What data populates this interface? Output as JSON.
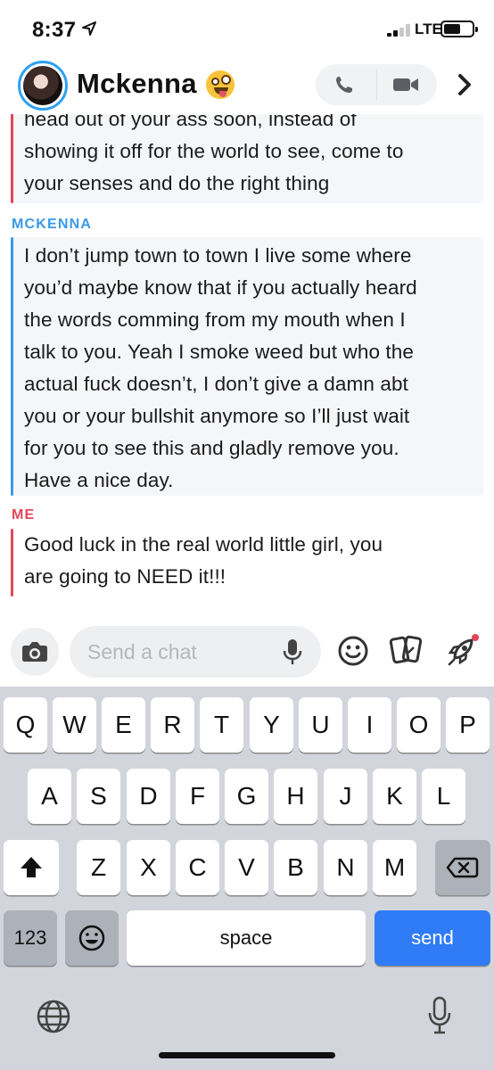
{
  "status_bar": {
    "time": "8:37",
    "network": "LTE"
  },
  "header": {
    "contact_name": "Mckenna",
    "emoji": "zany-face-emoji"
  },
  "messages": [
    {
      "sender": "",
      "color": "#e0475a",
      "text": "head out of your ass soon, instead of\nshowing it off for the world to see, come to\nyour senses and do the right thing"
    },
    {
      "sender": "MCKENNA",
      "color": "#3a9ae8",
      "text": "I don’t jump town to town I live some where\nyou’d maybe know that if you actually heard\nthe words comming  from my mouth when I\ntalk to you. Yeah I smoke weed but who the\nactual fuck doesn’t, I don’t give a damn abt\nyou or your bullshit anymore so I’ll just wait\nfor you to see this and gladly remove you.\nHave a nice day."
    },
    {
      "sender": "ME",
      "color": "#e0475a",
      "text": "Good luck in the real world little girl, you\nare going to NEED it!!!"
    }
  ],
  "composer": {
    "placeholder": "Send a chat",
    "value": ""
  },
  "keyboard": {
    "row1": [
      "Q",
      "W",
      "E",
      "R",
      "T",
      "Y",
      "U",
      "I",
      "O",
      "P"
    ],
    "row2": [
      "A",
      "S",
      "D",
      "F",
      "G",
      "H",
      "J",
      "K",
      "L"
    ],
    "row3": [
      "Z",
      "X",
      "C",
      "V",
      "B",
      "N",
      "M"
    ],
    "numbers_label": "123",
    "space_label": "space",
    "send_label": "send"
  },
  "colors": {
    "accent_blue": "#3a9ae8",
    "accent_red": "#e0475a",
    "send_blue": "#2f7cf6"
  }
}
